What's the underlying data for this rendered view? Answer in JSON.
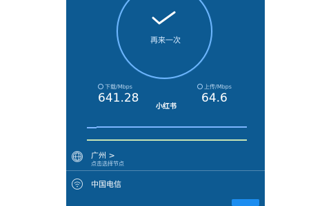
{
  "retry_label": "再来一次",
  "metrics": {
    "download_label": "下载/Mbps",
    "download_value": "641.28",
    "upload_label": "上传/Mbps",
    "upload_value": "64.6"
  },
  "watermark": "小红书",
  "location": {
    "title": "广州 >",
    "subtitle": "点击选择节点"
  },
  "carrier": {
    "title": "中国电信"
  },
  "footer": {
    "notice": "",
    "action_label": ""
  },
  "colors": {
    "background": "#0d5a92",
    "ring": "#6eb7ff",
    "download_line": "#7db6ff",
    "upload_line": "#c8e6b6",
    "button": "#1c8df0"
  },
  "icons": {
    "check": "check-icon",
    "download": "download-icon",
    "upload": "upload-icon",
    "globe": "globe-icon",
    "wifi": "wifi-icon"
  }
}
